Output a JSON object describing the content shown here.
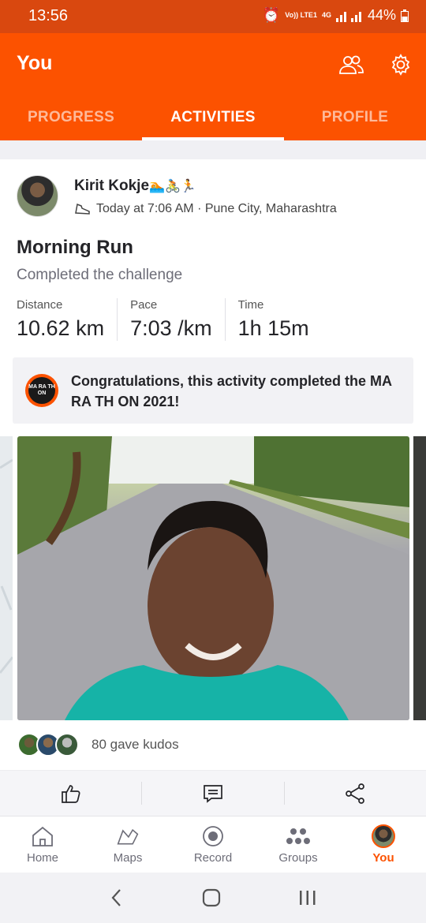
{
  "status_bar": {
    "time": "13:56",
    "network_label": "Vo)) LTE1",
    "network_type": "4G",
    "battery": "44%"
  },
  "header": {
    "title": "You",
    "tabs": [
      {
        "label": "PROGRESS"
      },
      {
        "label": "ACTIVITIES"
      },
      {
        "label": "PROFILE"
      }
    ],
    "active_tab": "ACTIVITIES"
  },
  "activity": {
    "athlete_name": "Kirit Kokje",
    "athlete_emoji": "🏊🚴🏃",
    "timestamp": "Today at 7:06 AM · Pune City, Maharashtra",
    "title": "Morning Run",
    "description": "Completed the challenge",
    "stats": [
      {
        "label": "Distance",
        "value": "10.62 km"
      },
      {
        "label": "Pace",
        "value": "7:03 /km"
      },
      {
        "label": "Time",
        "value": "1h 15m"
      }
    ],
    "challenge": {
      "badge_text": "MA RA TH ON",
      "message": "Congratulations, this activity completed the MA RA TH ON 2021!"
    },
    "kudos_text": "80 gave kudos"
  },
  "bottom_nav": [
    {
      "label": "Home",
      "icon": "home-icon"
    },
    {
      "label": "Maps",
      "icon": "map-icon"
    },
    {
      "label": "Record",
      "icon": "record-icon"
    },
    {
      "label": "Groups",
      "icon": "groups-icon"
    },
    {
      "label": "You",
      "icon": "avatar"
    }
  ],
  "colors": {
    "brand": "#fc5200",
    "status_bar": "#d9480f"
  }
}
